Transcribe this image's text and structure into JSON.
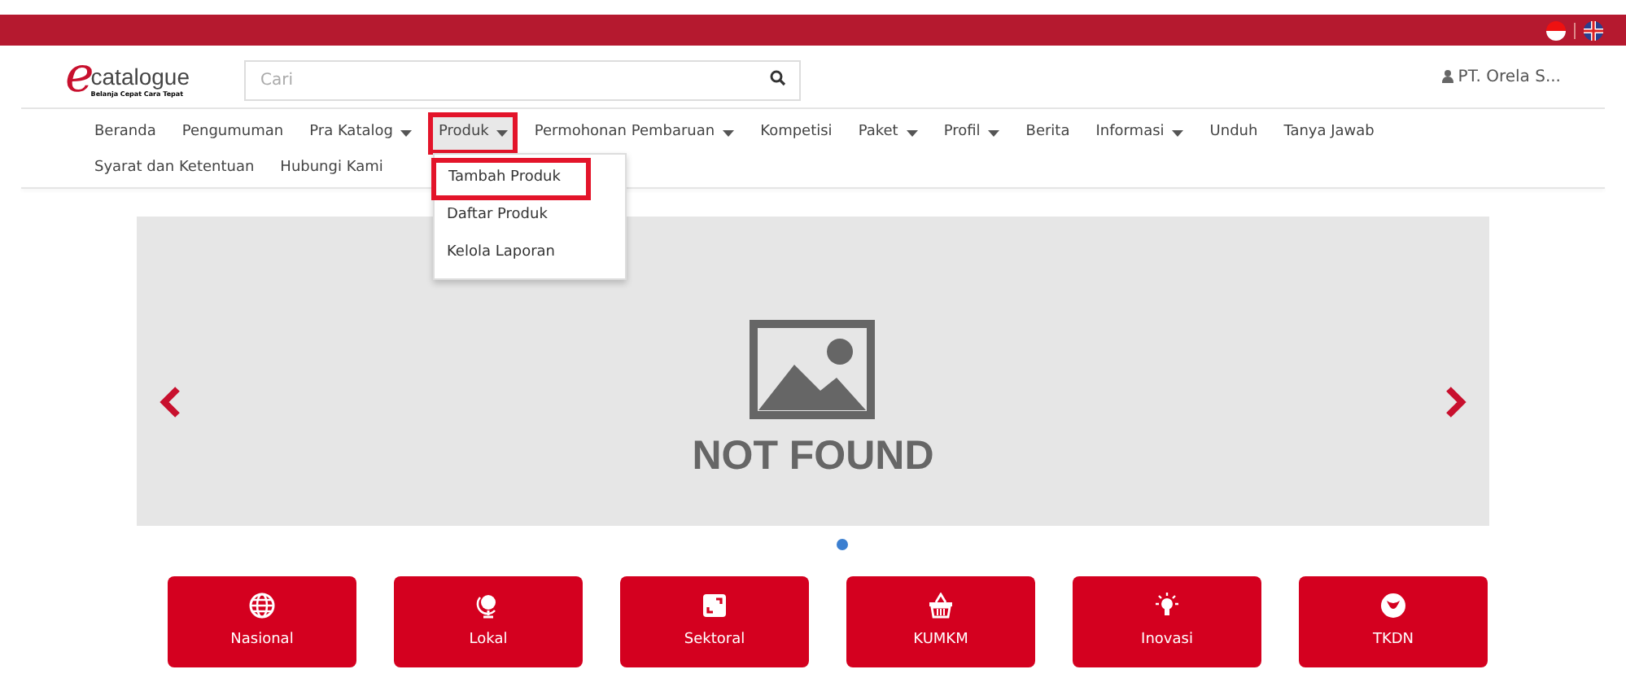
{
  "header": {
    "logo_text": "catalogue",
    "logo_letter": "e",
    "logo_tagline": "Belanja Cepat Cara Tepat",
    "search": {
      "placeholder": "Cari"
    },
    "user": "PT. Orela S..."
  },
  "nav": [
    {
      "label": "Beranda",
      "dropdown": false,
      "expanded": false,
      "highlighted": false
    },
    {
      "label": "Pengumuman",
      "dropdown": false,
      "expanded": false,
      "highlighted": false
    },
    {
      "label": "Pra Katalog",
      "dropdown": true,
      "expanded": false,
      "highlighted": false
    },
    {
      "label": "Produk",
      "dropdown": true,
      "expanded": true,
      "highlighted": true,
      "menu": [
        {
          "label": "Tambah Produk",
          "highlighted": true
        },
        {
          "label": "Daftar Produk",
          "highlighted": false
        },
        {
          "label": "Kelola Laporan",
          "highlighted": false
        }
      ]
    },
    {
      "label": "Permohonan Pembaruan",
      "dropdown": true,
      "expanded": false,
      "highlighted": false
    },
    {
      "label": "Kompetisi",
      "dropdown": false,
      "expanded": false,
      "highlighted": false
    },
    {
      "label": "Paket",
      "dropdown": true,
      "expanded": false,
      "highlighted": false
    },
    {
      "label": "Profil",
      "dropdown": true,
      "expanded": false,
      "highlighted": false
    },
    {
      "label": "Berita",
      "dropdown": false,
      "expanded": false,
      "highlighted": false
    },
    {
      "label": "Informasi",
      "dropdown": true,
      "expanded": false,
      "highlighted": false
    },
    {
      "label": "Unduh",
      "dropdown": false,
      "expanded": false,
      "highlighted": false
    },
    {
      "label": "Tanya Jawab",
      "dropdown": false,
      "expanded": false,
      "highlighted": false
    },
    {
      "label": "Syarat dan Ketentuan",
      "dropdown": false,
      "expanded": false,
      "highlighted": false
    },
    {
      "label": "Hubungi Kami",
      "dropdown": false,
      "expanded": false,
      "highlighted": false
    }
  ],
  "carousel": {
    "image_text": "NOT FOUND",
    "dots": [
      {
        "selected": true
      }
    ]
  },
  "tiles": [
    {
      "label": "Nasional",
      "kind": "globe"
    },
    {
      "label": "Lokal",
      "kind": "desk-globe"
    },
    {
      "label": "Sektoral",
      "kind": "expand"
    },
    {
      "label": "KUMKM",
      "kind": "basket"
    },
    {
      "label": "Inovasi",
      "kind": "bulb"
    },
    {
      "label": "TKDN",
      "kind": "emblem"
    }
  ]
}
